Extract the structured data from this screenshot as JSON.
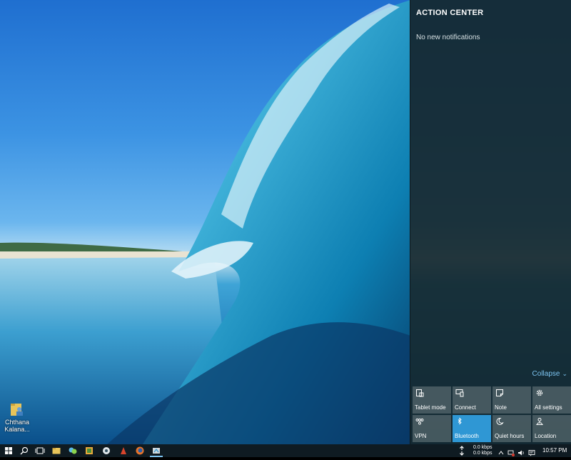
{
  "desktop": {
    "icons": [
      {
        "name": "folder-user-icon",
        "label_line1": "Chthana",
        "label_line2": "Kalana..."
      }
    ]
  },
  "action_center": {
    "title": "ACTION CENTER",
    "empty_message": "No new notifications",
    "collapse_label": "Collapse",
    "accent_color": "#2f97d4",
    "quick_actions": [
      {
        "label": "Tablet mode",
        "icon": "tablet-mode-icon",
        "active": false
      },
      {
        "label": "Connect",
        "icon": "connect-icon",
        "active": false
      },
      {
        "label": "Note",
        "icon": "note-icon",
        "active": false
      },
      {
        "label": "All settings",
        "icon": "settings-gear-icon",
        "active": false
      },
      {
        "label": "VPN",
        "icon": "vpn-icon",
        "active": false
      },
      {
        "label": "Bluetooth",
        "icon": "bluetooth-icon",
        "active": true
      },
      {
        "label": "Quiet hours",
        "icon": "moon-icon",
        "active": false
      },
      {
        "label": "Location",
        "icon": "location-icon",
        "active": false
      }
    ]
  },
  "taskbar": {
    "apps": [
      "start-icon",
      "search-icon",
      "task-view-icon",
      "file-explorer-icon",
      "chat-app-icon",
      "media-app-icon",
      "app-icon",
      "app-red-icon",
      "firefox-icon",
      "running-app-icon"
    ],
    "network_up": "0.0 kbps",
    "network_down": "0.0 kbps",
    "clock": "10:57 PM"
  }
}
